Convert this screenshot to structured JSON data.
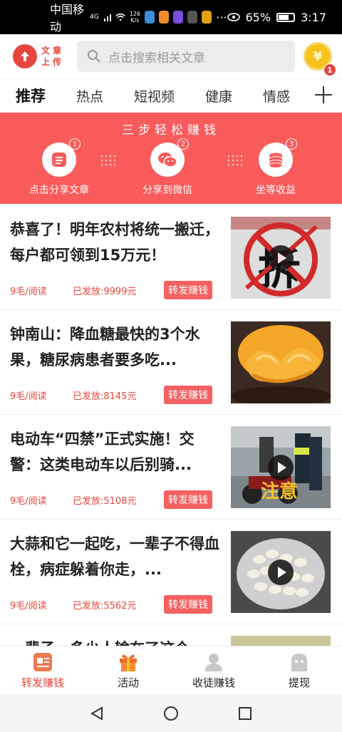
{
  "status_bar": {
    "carrier": "中国移动",
    "network": "4G",
    "speed_value": "126",
    "speed_unit": "K/s",
    "battery": "65%",
    "time": "3:17"
  },
  "header": {
    "logo_text": "文章上传",
    "search_placeholder": "点击搜索相关文章",
    "coin_symbol": "¥",
    "coin_badge": "1"
  },
  "tabs": [
    {
      "label": "推荐",
      "active": true
    },
    {
      "label": "热点",
      "active": false
    },
    {
      "label": "短视频",
      "active": false
    },
    {
      "label": "健康",
      "active": false
    },
    {
      "label": "情感",
      "active": false
    }
  ],
  "banner": {
    "title": "三步轻松赚钱",
    "steps": [
      {
        "num": "1",
        "label": "点击分享文章",
        "icon": "article-icon"
      },
      {
        "num": "2",
        "label": "分享到微信",
        "icon": "wechat-icon"
      },
      {
        "num": "3",
        "label": "坐等收益",
        "icon": "coins-icon"
      }
    ]
  },
  "feed": [
    {
      "title": "恭喜了！明年农村将统一搬迁，每户都可领到15万元！",
      "rate": "9毛/阅读",
      "paid": "已发放:9999元",
      "button": "转发赚钱",
      "thumb_text": "拆"
    },
    {
      "title": "钟南山：降血糖最快的3个水果，糖尿病患者要多吃...",
      "rate": "9毛/阅读",
      "paid": "已发放:8145元",
      "button": "转发赚钱",
      "thumb_text": ""
    },
    {
      "title": "电动车“四禁”正式实施！交警：这类电动车以后别骑...",
      "rate": "9毛/阅读",
      "paid": "已发放:5108元",
      "button": "转发赚钱",
      "thumb_text": "注意"
    },
    {
      "title": "大蒜和它一起吃，一辈子不得血栓，病症躲着你走，...",
      "rate": "9毛/阅读",
      "paid": "已发放:5562元",
      "button": "转发赚钱",
      "thumb_text": ""
    },
    {
      "title": "一辈子，多少人输在了这个",
      "rate": "",
      "paid": "",
      "button": "",
      "thumb_text": ""
    }
  ],
  "bottom_nav": [
    {
      "label": "转发赚钱",
      "active": true,
      "icon": "article-icon"
    },
    {
      "label": "活动",
      "active": false,
      "icon": "gift-icon"
    },
    {
      "label": "收徒赚钱",
      "active": false,
      "icon": "user-icon"
    },
    {
      "label": "提现",
      "active": false,
      "icon": "withdraw-icon"
    }
  ],
  "colors": {
    "accent": "#e8453c",
    "banner": "#f95b5b",
    "button": "#f56060"
  }
}
